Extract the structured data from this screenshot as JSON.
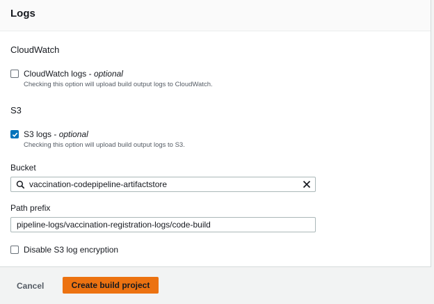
{
  "logs": {
    "title": "Logs",
    "cloudwatch": {
      "section_title": "CloudWatch",
      "checkbox_label": "CloudWatch logs - ",
      "checkbox_optional": "optional",
      "description": "Checking this option will upload build output logs to CloudWatch.",
      "checked": false
    },
    "s3": {
      "section_title": "S3",
      "checkbox_label": "S3 logs - ",
      "checkbox_optional": "optional",
      "description": "Checking this option will upload build output logs to S3.",
      "checked": true
    },
    "bucket": {
      "label": "Bucket",
      "value": "vaccination-codepipeline-artifactstore"
    },
    "path_prefix": {
      "label": "Path prefix",
      "value": "pipeline-logs/vaccination-registration-logs/code-build"
    },
    "disable_encryption": {
      "label": "Disable S3 log encryption",
      "checked": false
    }
  },
  "footer": {
    "cancel_label": "Cancel",
    "create_label": "Create build project"
  },
  "colors": {
    "primary": "#ec7211",
    "checkbox_checked": "#0073bb"
  }
}
